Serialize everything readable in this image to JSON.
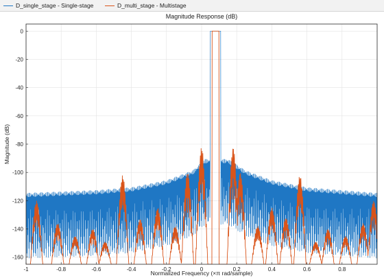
{
  "legend": {
    "single": "D_single_stage - Single-stage",
    "multi": "D_multi_stage - Multistage"
  },
  "colors": {
    "single": "#1f77c4",
    "multi": "#d9541a",
    "grid": "#e3e3e3",
    "axis": "#262626"
  },
  "chart_data": {
    "type": "line",
    "title": "Magnitude Response (dB)",
    "xlabel": "Normalized Frequency (×π rad/sample)",
    "ylabel": "Magnitude (dB)",
    "xlim": [
      -1,
      1
    ],
    "ylim": [
      -165,
      5
    ],
    "grid": true,
    "legend_position": "top",
    "x_ticks": [
      -1,
      -0.8,
      -0.6,
      -0.4,
      -0.2,
      0,
      0.2,
      0.4,
      0.6,
      0.8
    ],
    "x_tick_labels": [
      "-1",
      "-0.8",
      "-0.6",
      "-0.4",
      "-0.2",
      "0",
      "0.2",
      "0.4",
      "0.6",
      "0.8"
    ],
    "y_ticks": [
      0,
      -20,
      -40,
      -60,
      -80,
      -100,
      -120,
      -140,
      -160
    ],
    "y_tick_labels": [
      "0",
      "-20",
      "-40",
      "-60",
      "-80",
      "-100",
      "-120",
      "-140",
      "-160"
    ],
    "series": [
      {
        "name": "D_single_stage - Single-stage",
        "passband": [
          0.05,
          0.11
        ],
        "passband_db": 0,
        "stopband_envelope": [
          [
            -1,
            -116
          ],
          [
            -0.6,
            -114
          ],
          [
            -0.4,
            -112
          ],
          [
            -0.2,
            -107
          ],
          [
            -0.05,
            -100
          ],
          [
            0.02,
            -92
          ],
          [
            0.15,
            -92
          ],
          [
            0.25,
            -100
          ],
          [
            0.4,
            -107
          ],
          [
            0.6,
            -112
          ],
          [
            0.8,
            -114
          ],
          [
            1,
            -116
          ]
        ],
        "stopband_floor": -165
      },
      {
        "name": "D_multi_stage - Multistage",
        "passband": [
          0.06,
          0.1
        ],
        "passband_db": 0,
        "stopband_peaks": [
          [
            -0.94,
            -120
          ],
          [
            -0.82,
            -136
          ],
          [
            -0.72,
            -145
          ],
          [
            -0.62,
            -140
          ],
          [
            -0.55,
            -149
          ],
          [
            -0.45,
            -102
          ],
          [
            -0.35,
            -133
          ],
          [
            -0.25,
            -125
          ],
          [
            -0.15,
            -138
          ],
          [
            -0.08,
            -100
          ],
          [
            0.0,
            -82
          ],
          [
            0.18,
            -82
          ],
          [
            0.22,
            -100
          ],
          [
            0.32,
            -138
          ],
          [
            0.4,
            -125
          ],
          [
            0.48,
            -132
          ],
          [
            0.56,
            -102
          ],
          [
            0.65,
            -149
          ],
          [
            0.72,
            -140
          ],
          [
            0.82,
            -145
          ],
          [
            0.92,
            -136
          ],
          [
            0.98,
            -120
          ]
        ],
        "stopband_floor": -165
      }
    ]
  }
}
